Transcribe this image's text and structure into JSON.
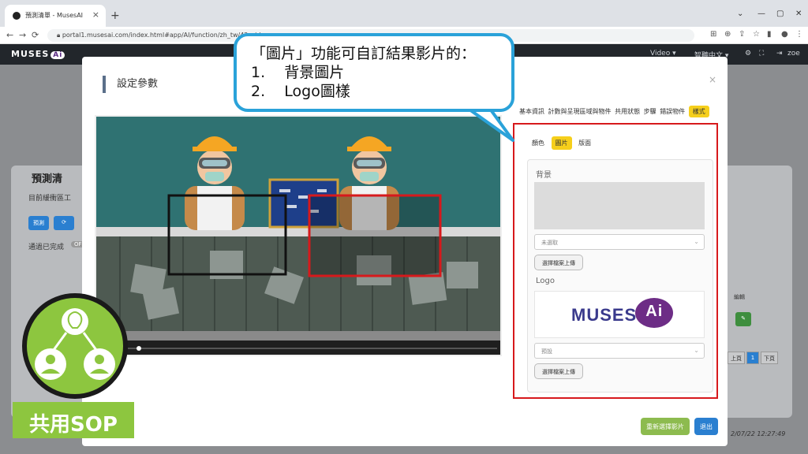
{
  "browser": {
    "tab_title": "預測清單 - MusesAI",
    "url": "portal1.musesai.com/index.html#app/AI/function/zh_tw/42_vide",
    "close_glyph": "×",
    "newtab_glyph": "+"
  },
  "app": {
    "logo_text": "MUSES",
    "logo_ai": "Ai",
    "video_menu": "Video ▾",
    "ai_menu": "智聽中文 ▾",
    "user": "zoe"
  },
  "background": {
    "title": "預測清",
    "description": "目前緩衝區工",
    "btn_predict": "預測",
    "btn_refresh": "⟳",
    "status": "通過已完成",
    "status_tag": "OFF",
    "col_edit": "編輯",
    "pager_prev": "上頁",
    "pager_page": "1",
    "pager_next": "下頁",
    "timestamp": "2/07/22 12:27:49"
  },
  "modal": {
    "title": "設定參數",
    "close_glyph": "×",
    "tabs": [
      "基本資訊",
      "計數與呈現區域與物件",
      "共用狀態",
      "步驟",
      "錯誤物件",
      "樣式"
    ],
    "active_tab": "樣式",
    "subtabs": [
      "顏色",
      "圖片",
      "版面"
    ],
    "active_subtab": "圖片",
    "background_label": "背景",
    "background_select": "未選取",
    "upload_label": "選擇檔案上傳",
    "logo_label": "Logo",
    "logo_select": "預設",
    "logo_brand": "MUSES",
    "logo_ai": "Ai",
    "btn_refresh_video": "重新選擇影片",
    "btn_exit": "退出"
  },
  "callout": {
    "line1": "「圖片」功能可自訂結果影片的：",
    "line2": "1.    背景圖片",
    "line3": "2.    Logo圖樣"
  },
  "sop": {
    "badge": "共用SOP"
  },
  "colors": {
    "accent_yellow": "#f6cf1b",
    "highlight_red": "#d7191c",
    "callout_blue": "#2aa2d9",
    "sop_green": "#8dc63f",
    "brand_purple": "#6d2d86"
  }
}
